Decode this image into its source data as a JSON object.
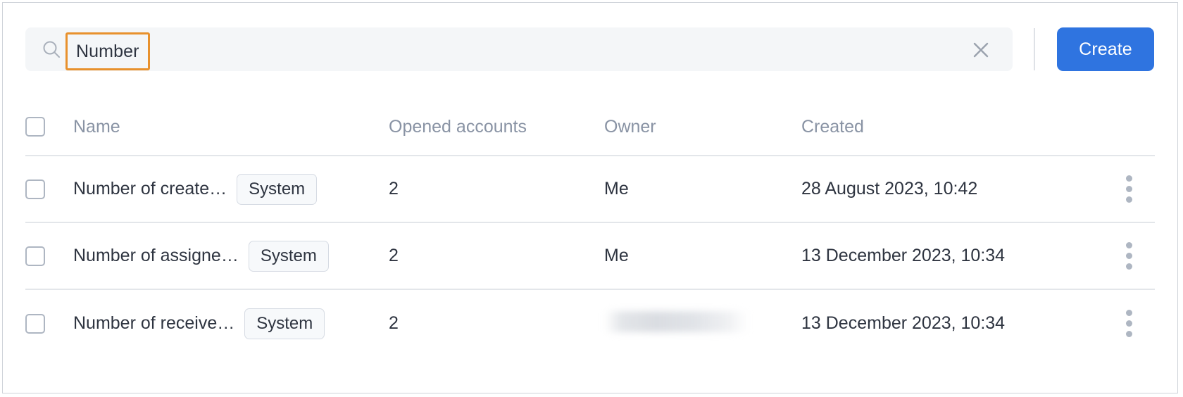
{
  "toolbar": {
    "search": {
      "value": "Number",
      "placeholder": "Search",
      "search_icon": "search-icon",
      "clear_icon": "close-icon"
    },
    "create_label": "Create"
  },
  "table": {
    "columns": [
      {
        "key": "name",
        "label": "Name"
      },
      {
        "key": "opened_accounts",
        "label": "Opened accounts"
      },
      {
        "key": "owner",
        "label": "Owner"
      },
      {
        "key": "created",
        "label": "Created"
      }
    ],
    "rows": [
      {
        "name": "Number of create…",
        "tag": "System",
        "opened_accounts": "2",
        "owner": "Me",
        "owner_redacted": false,
        "created": "28 August 2023, 10:42",
        "menu_icon": "kebab-menu-icon"
      },
      {
        "name": "Number of assigne…",
        "tag": "System",
        "opened_accounts": "2",
        "owner": "Me",
        "owner_redacted": false,
        "created": "13 December 2023, 10:34",
        "menu_icon": "kebab-menu-icon"
      },
      {
        "name": "Number of receive…",
        "tag": "System",
        "opened_accounts": "2",
        "owner": "",
        "owner_redacted": true,
        "created": "13 December 2023, 10:34",
        "menu_icon": "kebab-menu-icon"
      }
    ]
  },
  "colors": {
    "accent": "#2f74e0",
    "highlight": "#e8912d",
    "search_bg": "#f4f6f8",
    "header_text": "#8993a4",
    "body_text": "#2e3440",
    "divider": "#e3e6ea"
  }
}
